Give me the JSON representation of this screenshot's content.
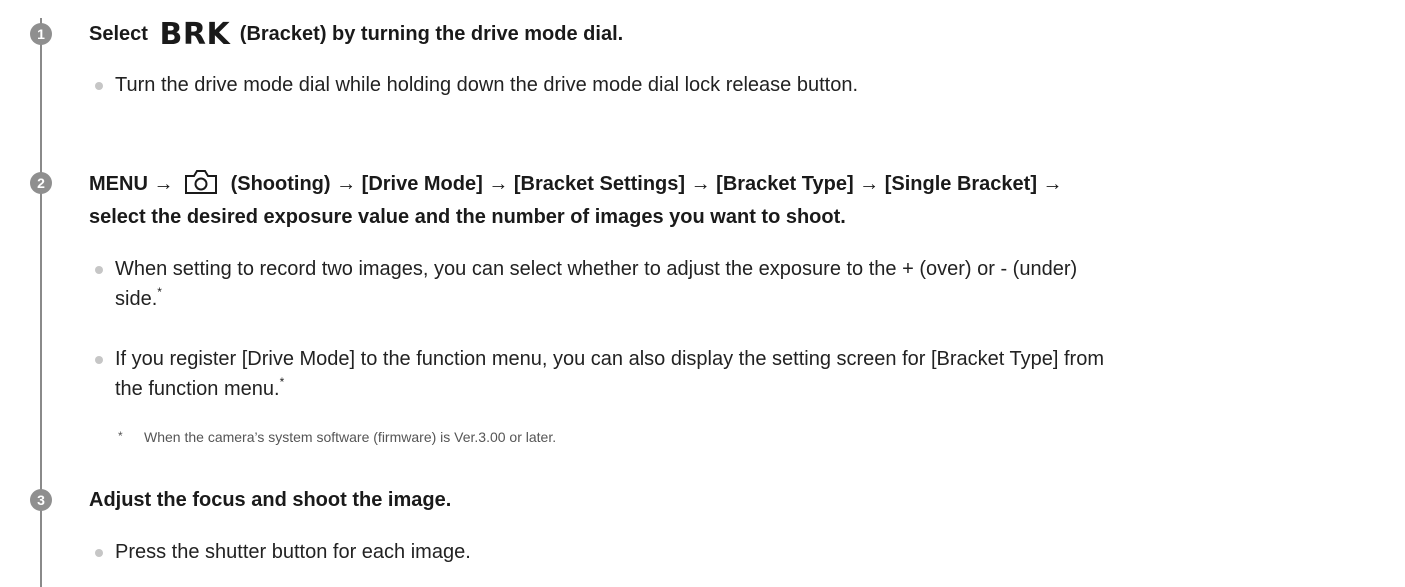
{
  "steps": [
    {
      "number": "1",
      "title_prefix": "Select",
      "title_icon_text": "BRK",
      "title_suffix": "(Bracket) by turning the drive mode dial.",
      "bullets": [
        {
          "text": "Turn the drive mode dial while holding down the drive mode dial lock release button."
        }
      ]
    },
    {
      "number": "2",
      "title_line1_prefix": "MENU →",
      "title_icon": "camera-shooting-icon",
      "title_line1_suffix": "(Shooting) → [Drive Mode] → [Bracket Settings] → [Bracket Type] → [Single Bracket] →",
      "title_line2": "select the desired exposure value and the number of images you want to shoot.",
      "bullets": [
        {
          "line1": "When setting to record two images, you can select whether to adjust the exposure to the + (over) or - (under)",
          "line2": "side.",
          "mark": "*"
        },
        {
          "line1": "If you register [Drive Mode] to the function menu, you can also display the setting screen for [Bracket Type] from",
          "line2": "the function menu.",
          "mark": "*"
        }
      ],
      "footnote": {
        "mark": "*",
        "text": "When the camera’s system software (firmware) is Ver.3.00 or later."
      }
    },
    {
      "number": "3",
      "title": "Adjust the focus and shoot the image.",
      "bullets": [
        {
          "text": "Press the shutter button for each image."
        }
      ]
    }
  ],
  "colors": {
    "badge": "#8f8f8f",
    "timeline": "#8a8a8a",
    "bullet": "#c6c6c6",
    "text": "#1a1a1a"
  }
}
